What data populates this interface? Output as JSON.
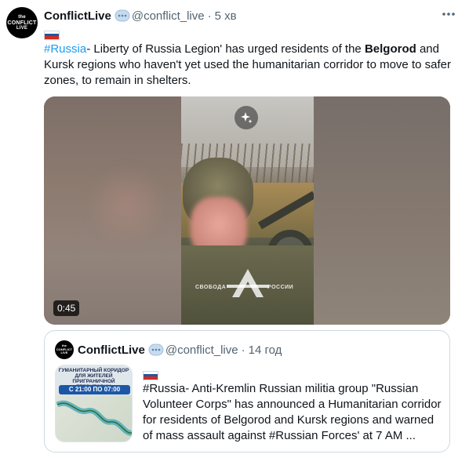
{
  "tweet": {
    "author_name": "ConflictLive",
    "handle": "@conflict_live",
    "separator": "·",
    "time": "5 хв",
    "avatar_text": [
      "the",
      "CONFLICT",
      "LIVE"
    ],
    "text_hashtag": "#Russia",
    "text_part1": "- Liberty of Russia Legion' has urged residents of the ",
    "text_bold1": "Belgorod",
    "text_part2": " and Kursk regions who haven't yet used the humanitarian corridor to move to safer zones, to remain in shelters."
  },
  "media": {
    "duration": "0:45",
    "watermark_left": "СВОБОДА",
    "watermark_right": "РОССИИ"
  },
  "quote": {
    "author_name": "ConflictLive",
    "handle": "@conflict_live",
    "separator": "·",
    "time": "14 год",
    "text": "#Russia- Anti-Kremlin Russian militia group \"Russian Volunteer Corps\" has announced a Humanitarian corridor for residents of Belgorod and Kursk regions and warned of mass assault against #Russian Forces' at 7 AM ...",
    "thumb_title": "ГУМАНИТАРНЫЙ КОРИДОР ДЛЯ ЖИТЕЛЕЙ ПРИГРАНИЧНОЙ ТЕРРИТОРИИ",
    "thumb_time": "С 21:00 ПО 07:00"
  },
  "colors": {
    "accent": "#1d9bf0",
    "secondary_text": "#536471",
    "border": "#cfd9de"
  },
  "icons": {
    "verified": "verified-badge-icon",
    "more": "more-horizontal-icon",
    "enhance": "sparkle-icon"
  }
}
